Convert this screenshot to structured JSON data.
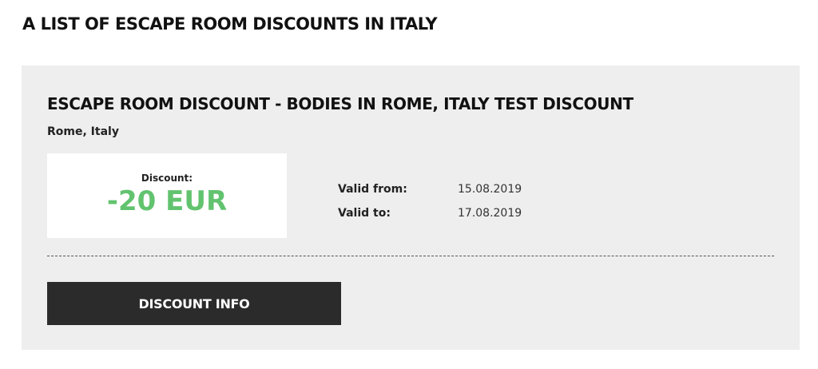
{
  "page": {
    "title": "A LIST OF ESCAPE ROOM DISCOUNTS IN ITALY"
  },
  "discount_card": {
    "title": "ESCAPE ROOM DISCOUNT - BODIES IN ROME, ITALY TEST DISCOUNT",
    "location": "Rome, Italy",
    "discount_label": "Discount:",
    "discount_value": "-20 EUR",
    "valid_from_label": "Valid from:",
    "valid_from": "15.08.2019",
    "valid_to_label": "Valid to:",
    "valid_to": "17.08.2019",
    "button_label": "DISCOUNT INFO"
  },
  "colors": {
    "card_background": "#eeeeee",
    "discount_green": "#62c36f",
    "button_background": "#2b2b2b"
  }
}
